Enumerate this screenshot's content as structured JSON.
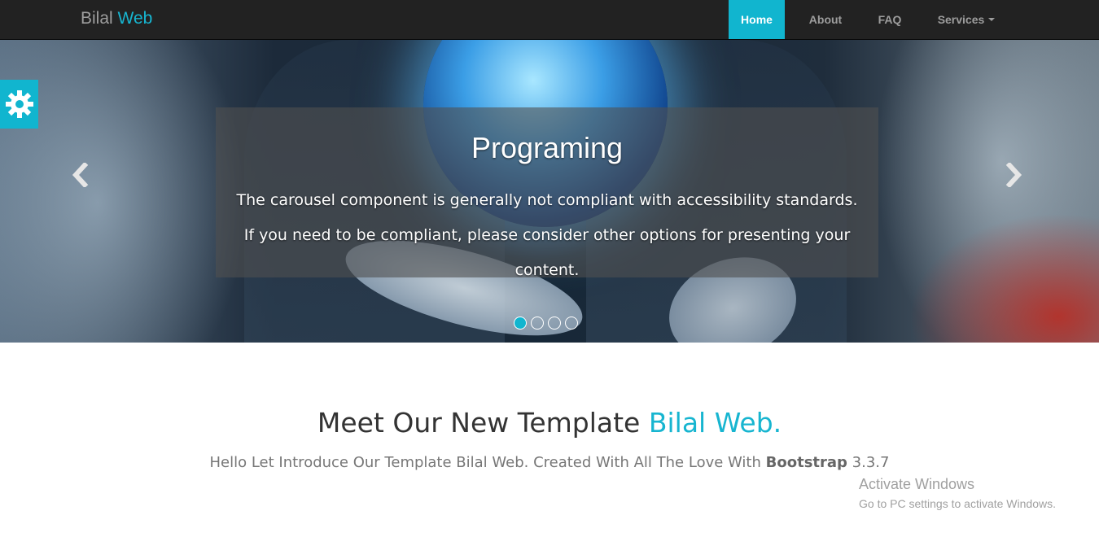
{
  "navbar": {
    "brand_main": "Bilal",
    "brand_accent": "Web",
    "items": [
      {
        "label": "Home",
        "active": true
      },
      {
        "label": "About",
        "active": false
      },
      {
        "label": "FAQ",
        "active": false
      },
      {
        "label": "Services",
        "active": false
      }
    ]
  },
  "carousel": {
    "caption_title": "Programing",
    "caption_text": "The carousel component is generally not compliant with accessibility standards. If you need to be compliant, please consider other options for presenting your content.",
    "indicator_count": 4,
    "active_indicator": 1
  },
  "main": {
    "headline_text": "Meet Our New Template",
    "headline_accent": "Bilal Web.",
    "subline_prefix": "Hello Let Introduce Our Template Bilal Web. Created With All The Love With",
    "subline_bold": "Bootstrap",
    "subline_suffix": "3.3.7"
  },
  "watermark": {
    "title": "Activate Windows",
    "subtitle": "Go to PC settings to activate Windows."
  },
  "colors": {
    "accent": "#11b5cf",
    "navbar_bg": "#222222"
  },
  "icons": {
    "settings": "gear-icon",
    "prev": "chevron-left-icon",
    "next": "chevron-right-icon",
    "dropdown": "caret-down-icon"
  }
}
